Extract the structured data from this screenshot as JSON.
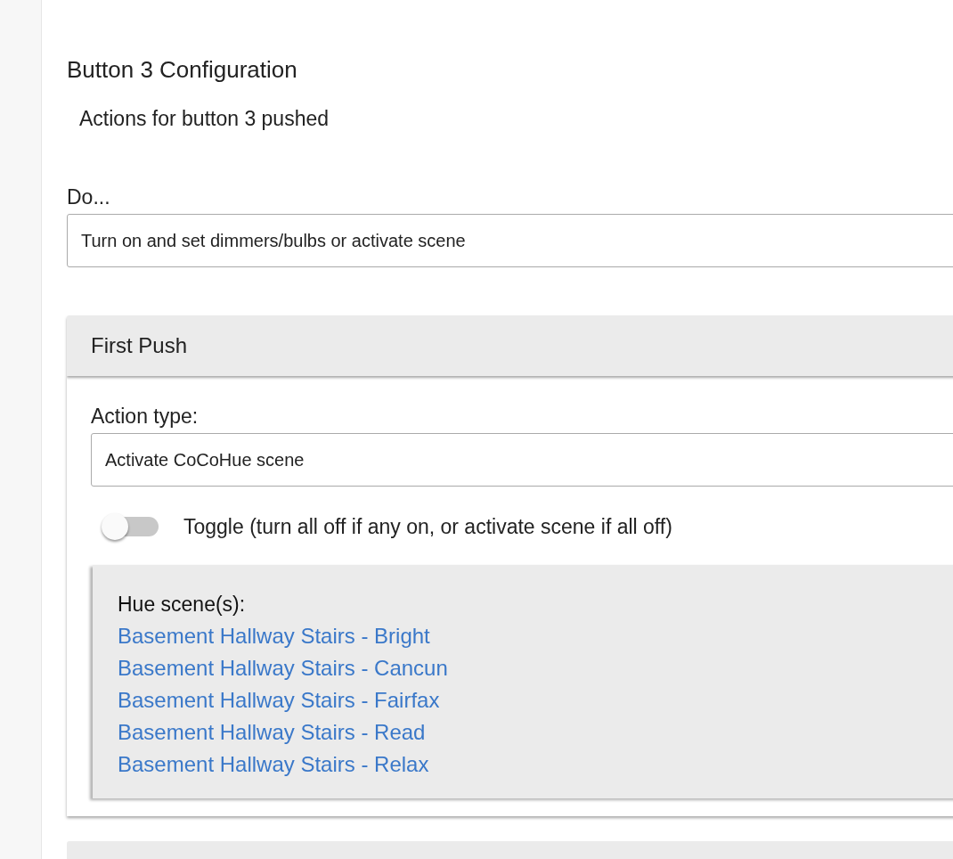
{
  "page": {
    "title": "Button 3 Configuration",
    "subtitle": "Actions for button 3 pushed"
  },
  "do_field": {
    "label": "Do...",
    "value": "Turn on and set dimmers/bulbs or activate scene"
  },
  "sections": [
    {
      "title": "First Push",
      "action_type": {
        "label": "Action type:",
        "value": "Activate CoCoHue scene"
      },
      "toggle": {
        "label": "Toggle (turn all off if any on, or activate scene if all off)",
        "on": false
      },
      "scenes": {
        "label": "Hue scene(s):",
        "items": [
          "Basement Hallway Stairs - Bright",
          "Basement Hallway Stairs - Cancun",
          "Basement Hallway Stairs - Fairfax",
          "Basement Hallway Stairs - Read",
          "Basement Hallway Stairs - Relax"
        ]
      }
    }
  ]
}
